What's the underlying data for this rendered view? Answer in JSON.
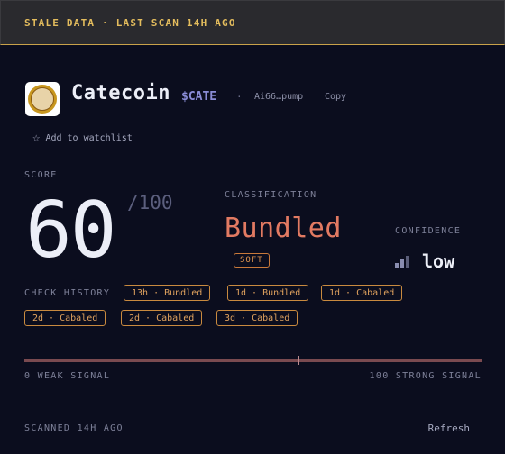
{
  "banner": {
    "text": "STALE DATA · LAST SCAN 14H AGO"
  },
  "token": {
    "name": "Catecoin",
    "ticker": "$CATE",
    "separator": "·",
    "address_short": "Ai66…pump",
    "copy_label": "Copy",
    "logo_icon": "cat-coin-logo"
  },
  "watchlist": {
    "label": "Add to watchlist",
    "icon": "star-outline-icon"
  },
  "score": {
    "label": "SCORE",
    "value": "60",
    "max": "/100"
  },
  "classification": {
    "label": "CLASSIFICATION",
    "value": "Bundled",
    "badge": "SOFT"
  },
  "confidence": {
    "label": "CONFIDENCE",
    "value": "low",
    "icon": "signal-bars-icon"
  },
  "history": {
    "label": "CHECK HISTORY",
    "items": [
      "13h · Bundled",
      "1d · Bundled",
      "1d · Cabaled",
      "2d · Cabaled",
      "2d · Cabaled",
      "3d · Cabaled"
    ]
  },
  "meter": {
    "value": 60,
    "min_label": "0 WEAK SIGNAL",
    "max_label": "100 STRONG SIGNAL"
  },
  "footer": {
    "scanned": "SCANNED 14H AGO",
    "refresh_label": "Refresh"
  },
  "colors": {
    "background": "#0b0d1e",
    "warning": "#e3bc5d",
    "classification": "#e27a62",
    "chip": "#e0a25e",
    "ticker": "#8a8cd6"
  }
}
